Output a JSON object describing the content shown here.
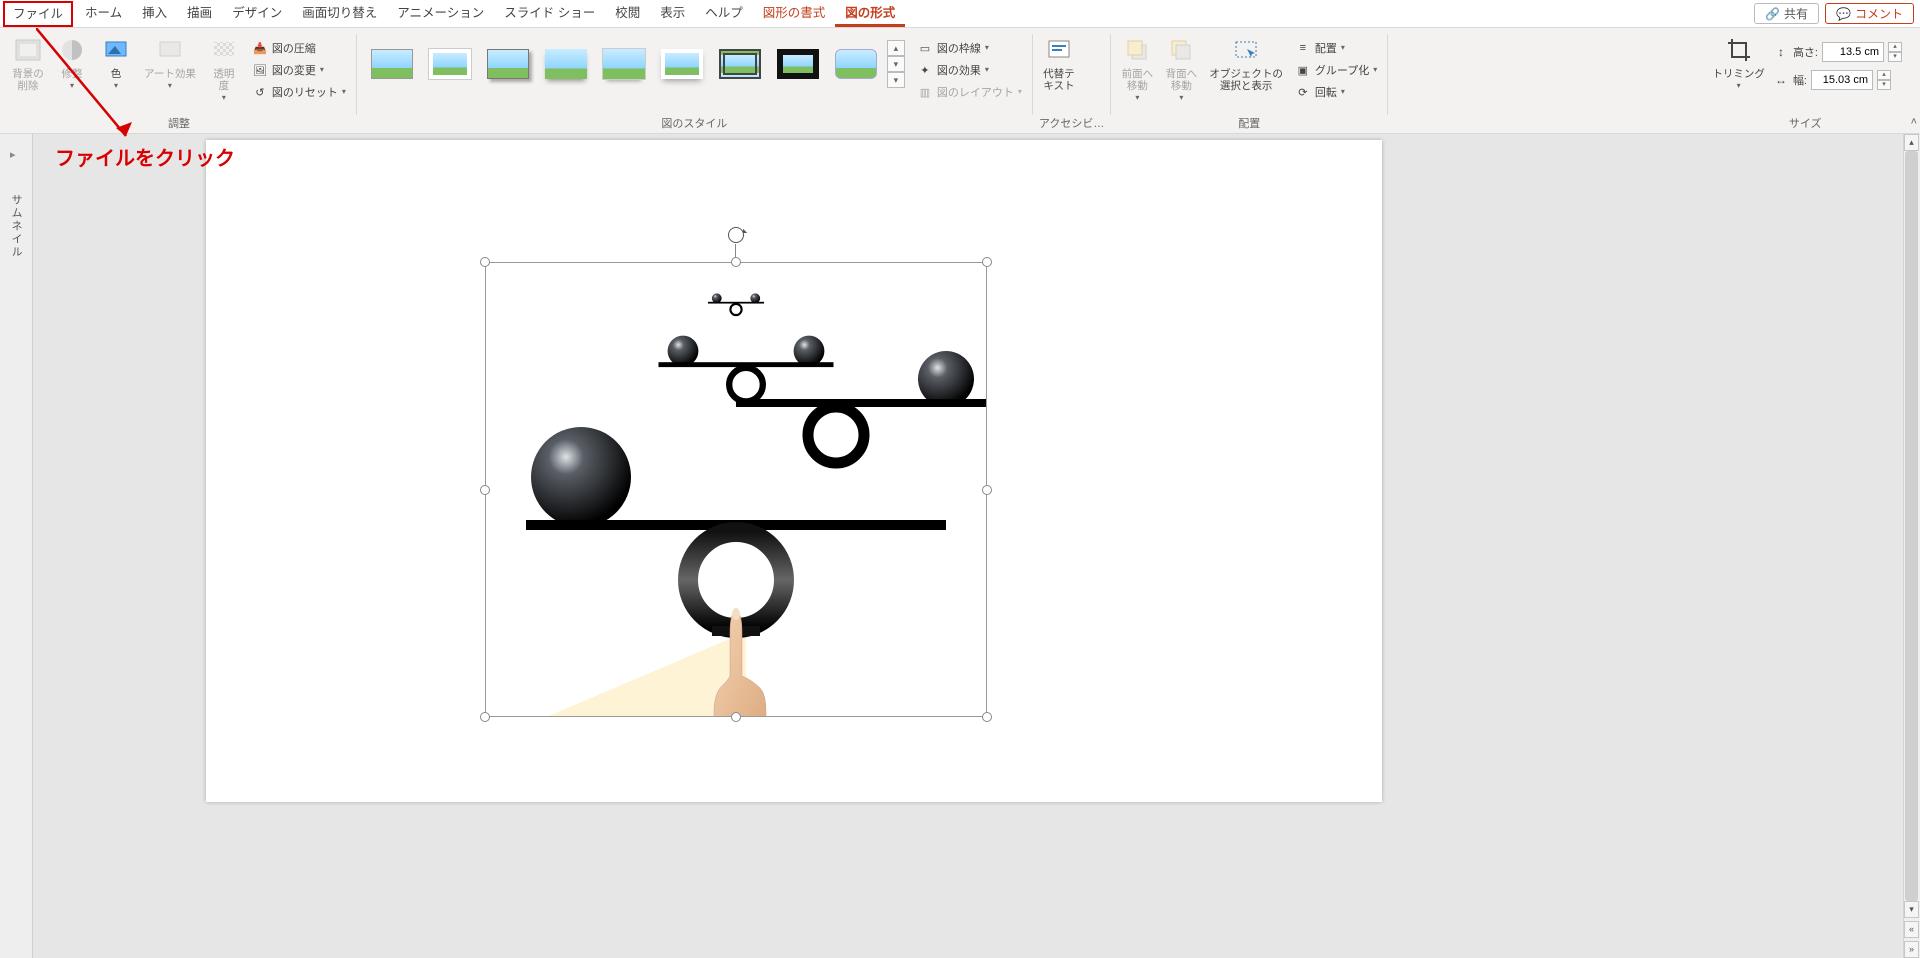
{
  "tabs": {
    "file": "ファイル",
    "home": "ホーム",
    "insert": "挿入",
    "draw": "描画",
    "design": "デザイン",
    "transitions": "画面切り替え",
    "animations": "アニメーション",
    "slideshow": "スライド ショー",
    "review": "校閲",
    "view": "表示",
    "help": "ヘルプ",
    "shape_format": "図形の書式",
    "picture_format": "図の形式"
  },
  "top_right": {
    "share": "共有",
    "comments": "コメント"
  },
  "ribbon": {
    "adjust": {
      "remove_bg": "背景の\n削除",
      "corrections": "修整",
      "color": "色",
      "artistic": "アート効果",
      "transparency": "透明\n度",
      "compress": "図の圧縮",
      "change": "図の変更",
      "reset": "図のリセット",
      "group_label": "調整"
    },
    "styles": {
      "border": "図の枠線",
      "effects": "図の効果",
      "layout": "図のレイアウト",
      "group_label": "図のスタイル"
    },
    "accessibility": {
      "alt_text": "代替テ\nキスト",
      "group_label": "アクセシビ…"
    },
    "arrange": {
      "bring_forward": "前面へ\n移動",
      "send_backward": "背面へ\n移動",
      "selection_pane": "オブジェクトの\n選択と表示",
      "align": "配置",
      "group": "グループ化",
      "rotate": "回転",
      "group_label": "配置"
    },
    "size": {
      "crop": "トリミング",
      "height_label": "高さ:",
      "height_value": "13.5 cm",
      "width_label": "幅:",
      "width_value": "15.03 cm",
      "group_label": "サイズ"
    }
  },
  "annotation": {
    "text": "ファイルをクリック"
  },
  "side_panel": {
    "label": "サムネイル"
  }
}
